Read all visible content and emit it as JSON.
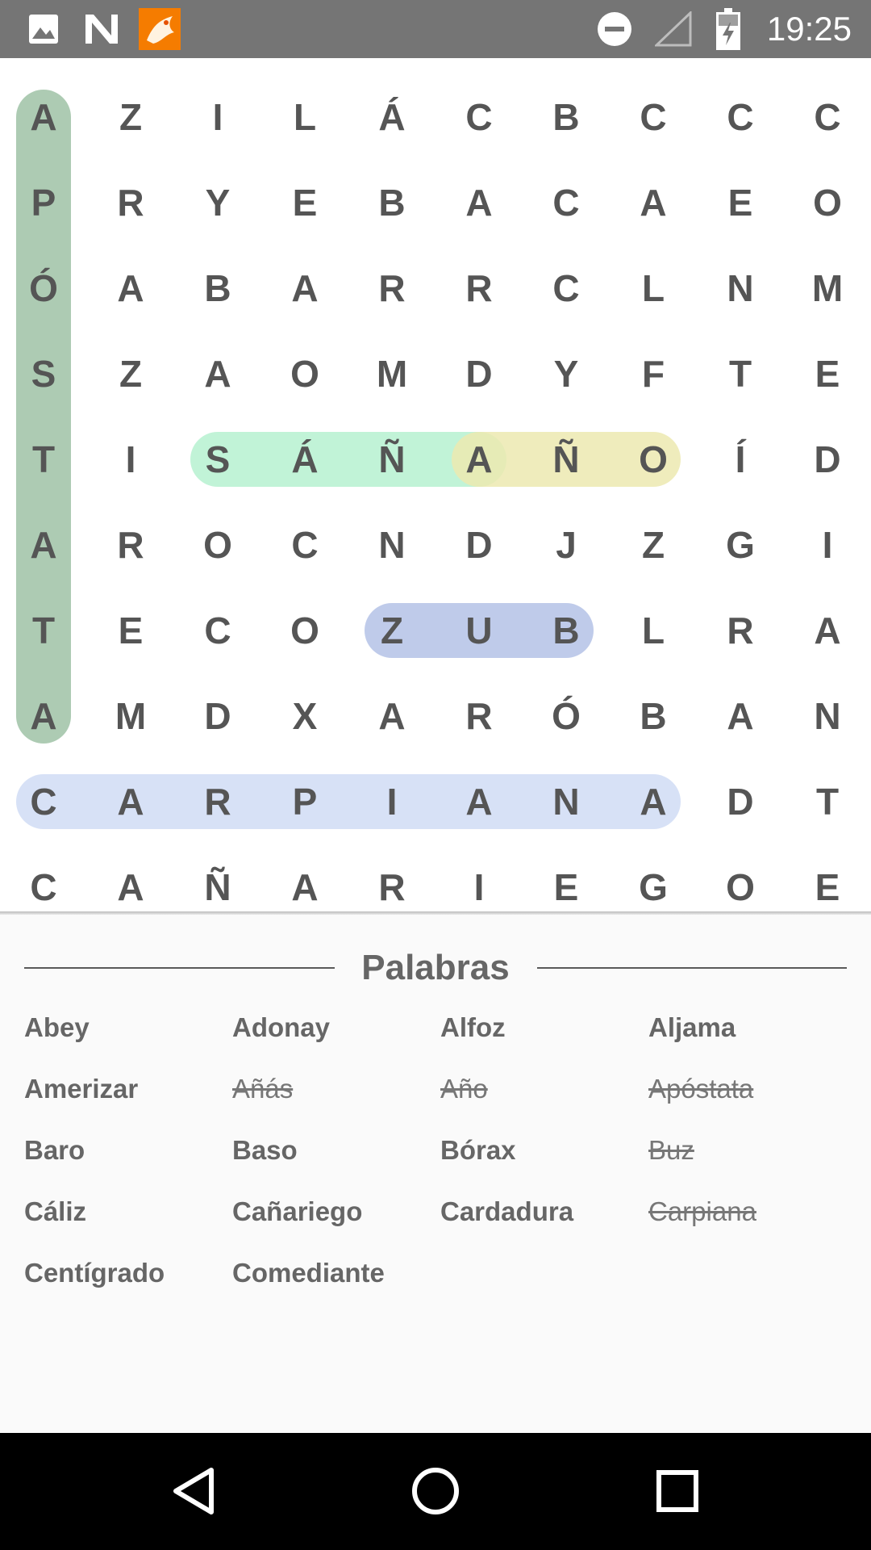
{
  "status_bar": {
    "time": "19:25",
    "icons": [
      "image-icon",
      "n-logo-icon",
      "app-fox-icon",
      "do-not-disturb-icon",
      "signal-icon",
      "battery-charging-icon"
    ]
  },
  "grid": [
    [
      "A",
      "Z",
      "I",
      "L",
      "Á",
      "C",
      "B",
      "C",
      "C",
      "C"
    ],
    [
      "P",
      "R",
      "Y",
      "E",
      "B",
      "A",
      "C",
      "A",
      "E",
      "O"
    ],
    [
      "Ó",
      "A",
      "B",
      "A",
      "R",
      "R",
      "C",
      "L",
      "N",
      "M"
    ],
    [
      "S",
      "Z",
      "A",
      "O",
      "M",
      "D",
      "Y",
      "F",
      "T",
      "E"
    ],
    [
      "T",
      "I",
      "S",
      "Á",
      "Ñ",
      "A",
      "Ñ",
      "O",
      "Í",
      "D"
    ],
    [
      "A",
      "R",
      "O",
      "C",
      "N",
      "D",
      "J",
      "Z",
      "G",
      "I"
    ],
    [
      "T",
      "E",
      "C",
      "O",
      "Z",
      "U",
      "B",
      "L",
      "R",
      "A"
    ],
    [
      "A",
      "M",
      "D",
      "X",
      "A",
      "R",
      "Ó",
      "B",
      "A",
      "N"
    ],
    [
      "C",
      "A",
      "R",
      "P",
      "I",
      "A",
      "N",
      "A",
      "D",
      "T"
    ],
    [
      "C",
      "A",
      "Ñ",
      "A",
      "R",
      "I",
      "E",
      "G",
      "O",
      "E"
    ]
  ],
  "found_highlights": [
    {
      "word": "Apóstata",
      "from": [
        0,
        0
      ],
      "to": [
        7,
        0
      ],
      "color": "#9fc2a6"
    },
    {
      "word": "Añás",
      "from": [
        4,
        2
      ],
      "to": [
        4,
        5
      ],
      "color": "#b6f1d0"
    },
    {
      "word": "Año",
      "from": [
        4,
        5
      ],
      "to": [
        4,
        7
      ],
      "color": "#ece9b0"
    },
    {
      "word": "Buz",
      "from": [
        6,
        4
      ],
      "to": [
        6,
        6
      ],
      "color": "#b4c2e6"
    },
    {
      "word": "Carpiana",
      "from": [
        8,
        0
      ],
      "to": [
        8,
        7
      ],
      "color": "#d0dcf4"
    }
  ],
  "words_panel": {
    "title": "Palabras",
    "words": [
      {
        "text": "Abey",
        "found": false
      },
      {
        "text": "Adonay",
        "found": false
      },
      {
        "text": "Alfoz",
        "found": false
      },
      {
        "text": "Aljama",
        "found": false
      },
      {
        "text": "Amerizar",
        "found": false
      },
      {
        "text": "Añás",
        "found": true
      },
      {
        "text": "Año",
        "found": true
      },
      {
        "text": "Apóstata",
        "found": true
      },
      {
        "text": "Baro",
        "found": false
      },
      {
        "text": "Baso",
        "found": false
      },
      {
        "text": "Bórax",
        "found": false
      },
      {
        "text": "Buz",
        "found": true
      },
      {
        "text": "Cáliz",
        "found": false
      },
      {
        "text": "Cañariego",
        "found": false
      },
      {
        "text": "Cardadura",
        "found": false
      },
      {
        "text": "Carpiana",
        "found": true
      },
      {
        "text": "Centígrado",
        "found": false
      },
      {
        "text": "Comediante",
        "found": false
      }
    ]
  },
  "nav_bar": {
    "buttons": [
      "back-icon",
      "home-icon",
      "recents-icon"
    ]
  }
}
